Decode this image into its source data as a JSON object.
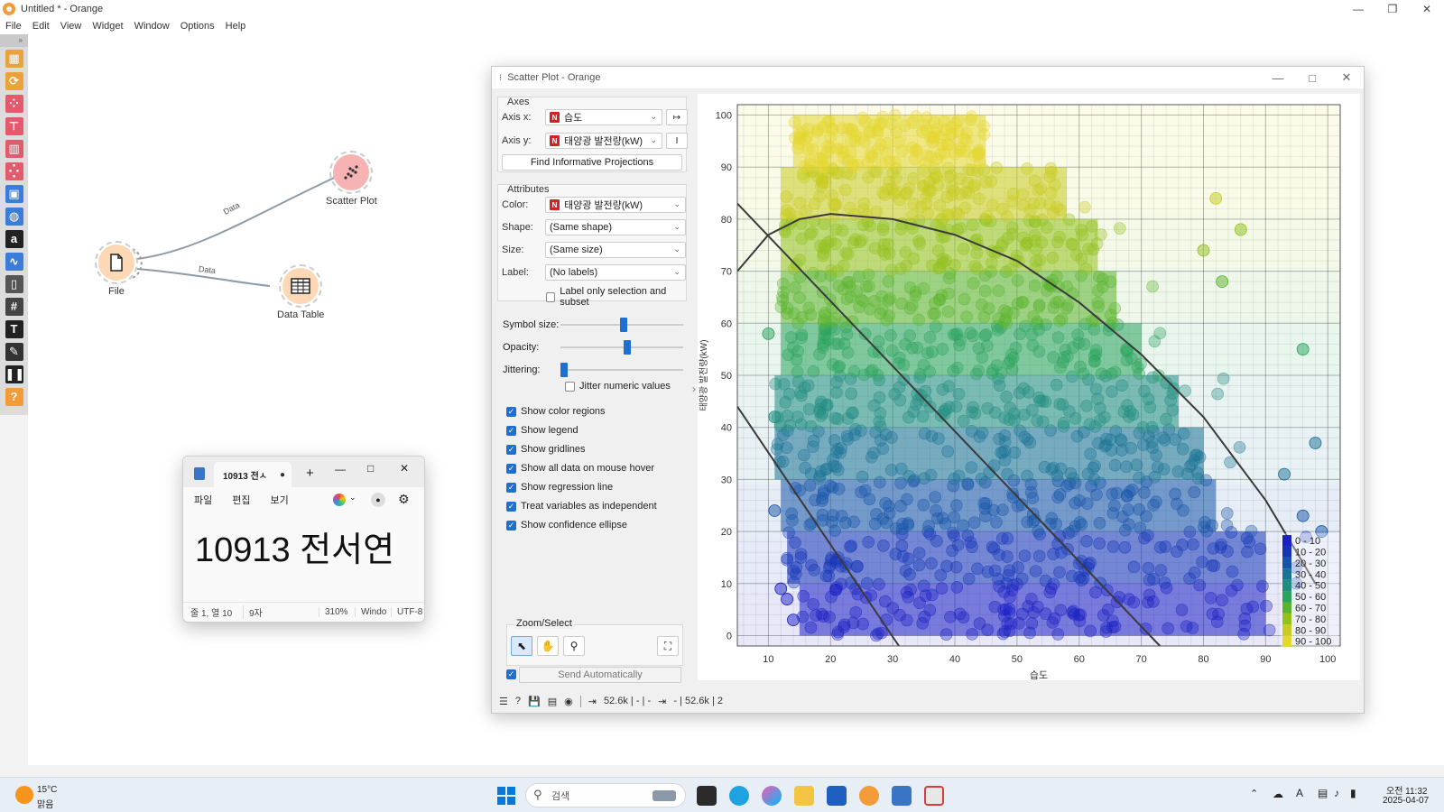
{
  "app": {
    "title": "Untitled * - Orange",
    "menu": [
      "File",
      "Edit",
      "View",
      "Widget",
      "Window",
      "Options",
      "Help"
    ]
  },
  "toolbox": {
    "icons": [
      "table-icon",
      "transform-icon",
      "scatter-icon",
      "tree-icon",
      "distribution-icon",
      "network-icon",
      "image-icon",
      "geo-icon",
      "text-icon",
      "timeseries-icon",
      "info-icon",
      "grid-icon",
      "annotation-text-icon",
      "pencil-icon",
      "pause-icon",
      "help-icon"
    ],
    "colors": [
      "#e9a33a",
      "#e9a33a",
      "#e25a6b",
      "#e25a6b",
      "#e25a6b",
      "#e25a6b",
      "#3b7dd8",
      "#3b7dd8",
      "#222222",
      "#3b7dd8",
      "#555555",
      "#444444",
      "#222222",
      "#333333",
      "#222222",
      "#f29b38"
    ]
  },
  "workflow": {
    "nodes": {
      "file": "File",
      "scatter": "Scatter Plot",
      "table": "Data Table"
    },
    "link1": "Data",
    "link2": "Data"
  },
  "scatter": {
    "title": "Scatter Plot - Orange",
    "axes_box": "Axes",
    "axis_x_label": "Axis x:",
    "axis_x_value": "습도",
    "axis_y_label": "Axis y:",
    "axis_y_value": "태양광 발전량(kW)",
    "find_projections": "Find Informative Projections",
    "attributes_box": "Attributes",
    "color_label": "Color:",
    "color_value": "태양광 발전량(kW)",
    "shape_label": "Shape:",
    "shape_value": "(Same shape)",
    "size_label": "Size:",
    "size_value": "(Same size)",
    "label_label": "Label:",
    "label_value": "(No labels)",
    "label_only": "Label only selection and subset",
    "symbol_size": "Symbol size:",
    "opacity": "Opacity:",
    "jittering": "Jittering:",
    "jitter_numeric": "Jitter numeric values",
    "checks": [
      "Show color regions",
      "Show legend",
      "Show gridlines",
      "Show all data on mouse hover",
      "Show regression line",
      "Treat variables as independent",
      "Show confidence ellipse"
    ],
    "zoom_title": "Zoom/Select",
    "send_auto": "Send Automatically",
    "status_in": "52.6k | - | -",
    "status_out": "- | 52.6k | 2"
  },
  "chart_data": {
    "type": "scatter",
    "xlabel": "습도",
    "ylabel": "태양광 발전량(kW)",
    "xlim": [
      5,
      102
    ],
    "ylim": [
      -2,
      102
    ],
    "x_ticks": [
      10,
      20,
      30,
      40,
      50,
      60,
      70,
      80,
      90,
      100
    ],
    "y_ticks": [
      0,
      10,
      20,
      30,
      40,
      50,
      60,
      70,
      80,
      90,
      100
    ],
    "grid": true,
    "legend_placement": "bottom-right",
    "legend": [
      "0 - 10",
      "10 - 20",
      "20 - 30",
      "30 - 40",
      "40 - 50",
      "50 - 60",
      "60 - 70",
      "70 - 80",
      "80 - 90",
      "90 - 100"
    ],
    "band_colors": [
      "#1b1fc4",
      "#1534b8",
      "#1553a8",
      "#1a7296",
      "#1f8d80",
      "#2aa35c",
      "#5bb42e",
      "#93c11c",
      "#c8cb20",
      "#e4d72f"
    ],
    "band_extent": [
      {
        "range": [
          0,
          10
        ],
        "x": [
          15,
          90
        ]
      },
      {
        "range": [
          10,
          20
        ],
        "x": [
          13,
          90
        ]
      },
      {
        "range": [
          20,
          30
        ],
        "x": [
          12,
          82
        ]
      },
      {
        "range": [
          30,
          40
        ],
        "x": [
          11,
          80
        ]
      },
      {
        "range": [
          40,
          50
        ],
        "x": [
          11,
          76
        ]
      },
      {
        "range": [
          50,
          60
        ],
        "x": [
          12,
          70
        ]
      },
      {
        "range": [
          60,
          70
        ],
        "x": [
          12,
          66
        ]
      },
      {
        "range": [
          70,
          80
        ],
        "x": [
          12,
          63
        ]
      },
      {
        "range": [
          80,
          90
        ],
        "x": [
          12,
          58
        ]
      },
      {
        "range": [
          90,
          100
        ],
        "x": [
          14,
          45
        ]
      }
    ],
    "outliers": [
      {
        "x": 82,
        "y": 84
      },
      {
        "x": 86,
        "y": 78
      },
      {
        "x": 80,
        "y": 74
      },
      {
        "x": 83,
        "y": 68
      },
      {
        "x": 96,
        "y": 55
      },
      {
        "x": 98,
        "y": 37
      },
      {
        "x": 93,
        "y": 31
      },
      {
        "x": 96,
        "y": 23
      },
      {
        "x": 99,
        "y": 20
      },
      {
        "x": 10,
        "y": 58
      },
      {
        "x": 11,
        "y": 42
      },
      {
        "x": 11,
        "y": 24
      },
      {
        "x": 12,
        "y": 9
      },
      {
        "x": 13,
        "y": 7
      },
      {
        "x": 14,
        "y": 3
      }
    ],
    "regression_lines": [
      {
        "x": [
          5,
          73
        ],
        "y": [
          83,
          -2
        ]
      },
      {
        "x": [
          5,
          31
        ],
        "y": [
          44,
          -2
        ]
      }
    ],
    "ellipse_curve": {
      "x": [
        5,
        10,
        15,
        20,
        30,
        40,
        50,
        60,
        70,
        80,
        90,
        98
      ],
      "y": [
        70,
        77,
        80,
        81,
        80,
        77,
        72,
        64,
        54,
        42,
        26,
        10
      ]
    }
  },
  "notepad": {
    "tab": "10913 전ㅅ",
    "menu": [
      "파일",
      "편집",
      "보기"
    ],
    "content": "10913 전서연",
    "status": [
      "줄 1, 열 10",
      "9자",
      "310%",
      "Windo",
      "UTF-8"
    ]
  },
  "taskbar": {
    "weather_temp": "15°C",
    "weather_desc": "맑음",
    "search_placeholder": "검색",
    "time": "오전 11:32",
    "date": "2025-04-07"
  }
}
